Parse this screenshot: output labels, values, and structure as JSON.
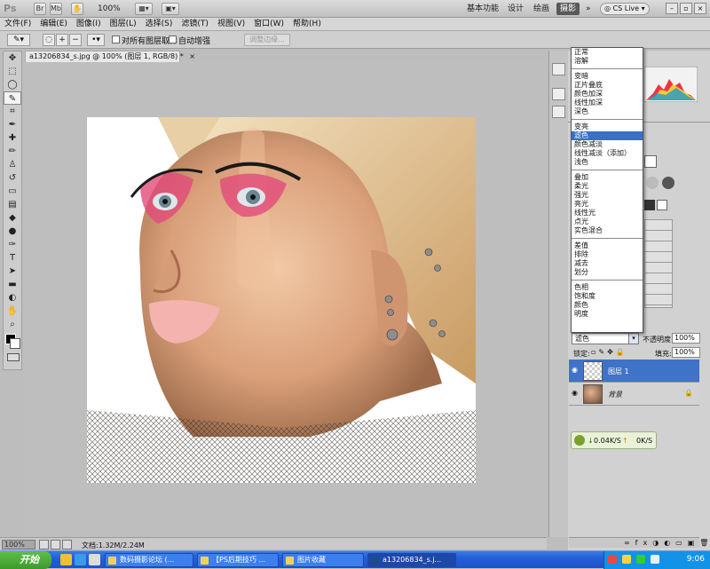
{
  "app": {
    "logo": "Ps",
    "zoom": "100%",
    "workspaces": [
      "基本功能",
      "设计",
      "绘画",
      "摄影"
    ],
    "active_workspace": "摄影",
    "cs_live": "CS Live"
  },
  "menu": [
    "文件(F)",
    "编辑(E)",
    "图像(I)",
    "图层(L)",
    "选择(S)",
    "滤镜(T)",
    "视图(V)",
    "窗口(W)",
    "帮助(H)"
  ],
  "options": {
    "sample_all_layers": "对所有图层取样",
    "auto_enhance": "自动增强",
    "refine_edge": "调整边缘..."
  },
  "document": {
    "tab_title": "a13206834_s.jpg @ 100% (图层 1, RGB/8) *",
    "close": "×",
    "zoom_field": "100%",
    "doc_size": "文档:1.32M/2.24M"
  },
  "blend_modes": {
    "groups": [
      [
        "正常",
        "溶解"
      ],
      [
        "变暗",
        "正片叠底",
        "颜色加深",
        "线性加深",
        "深色"
      ],
      [
        "变亮",
        "滤色",
        "颜色减淡",
        "线性减淡（添加）",
        "浅色"
      ],
      [
        "叠加",
        "柔光",
        "强光",
        "亮光",
        "线性光",
        "点光",
        "实色混合"
      ],
      [
        "差值",
        "排除",
        "减去",
        "划分"
      ],
      [
        "色相",
        "饱和度",
        "颜色",
        "明度"
      ]
    ],
    "highlighted": "滤色"
  },
  "layers_panel": {
    "blend_value": "滤色",
    "opacity_label": "不透明度:",
    "opacity": "100%",
    "lock_label": "锁定:",
    "fill_label": "填充:",
    "fill": "100%",
    "layers": [
      {
        "name": "图层 1",
        "selected": true
      },
      {
        "name": "背景",
        "selected": false
      }
    ]
  },
  "net_monitor": {
    "down": "0.04K/S",
    "up": "0K/S"
  },
  "taskbar": {
    "start": "开始",
    "items": [
      "数码摄影论坛 (...",
      "【PS后期技巧 ...",
      "图片收藏",
      "a13206834_s.j..."
    ],
    "clock": "9:06"
  },
  "colors": {
    "accent": "#3a6fc6",
    "taskbar": "#245edb",
    "start": "#3c9a2d"
  }
}
